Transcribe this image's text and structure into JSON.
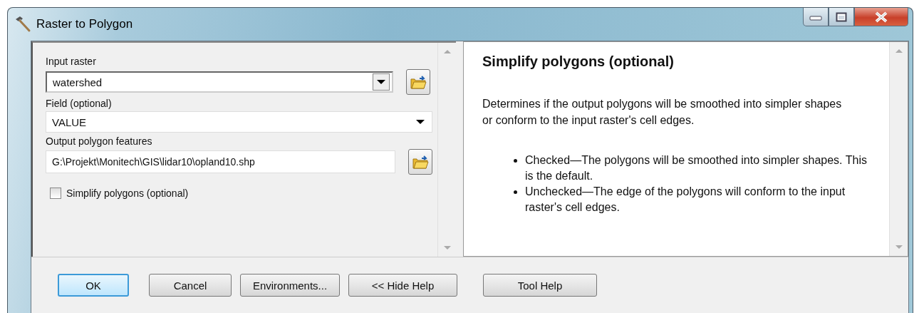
{
  "window": {
    "title": "Raster to Polygon"
  },
  "parameters": [
    {
      "kind": "combo",
      "label": "Input raster",
      "value": "watershed",
      "browse": true
    },
    {
      "kind": "dropdown",
      "label": "Field (optional)",
      "value": "VALUE",
      "browse": false
    },
    {
      "kind": "text",
      "label": "Output polygon features",
      "value": "G:\\Projekt\\Monitech\\GIS\\lidar10\\opland10.shp",
      "browse": true
    },
    {
      "kind": "checkbox",
      "label": "Simplify polygons (optional)",
      "checked": false
    }
  ],
  "help": {
    "title": "Simplify polygons (optional)",
    "paragraph": "Determines if the output polygons will be smoothed into simpler shapes or conform to the input raster's cell edges.",
    "bullets": [
      "Checked—The polygons will be smoothed into simpler shapes. This is the default.",
      "Unchecked—The edge of the polygons will conform to the input raster's cell edges."
    ]
  },
  "buttons": [
    {
      "label": "OK",
      "default": true
    },
    {
      "label": "Cancel",
      "default": false
    },
    {
      "label": "Environments...",
      "default": false
    },
    {
      "label": "<< Hide Help",
      "default": false
    },
    {
      "label": "Tool Help",
      "default": false
    }
  ]
}
